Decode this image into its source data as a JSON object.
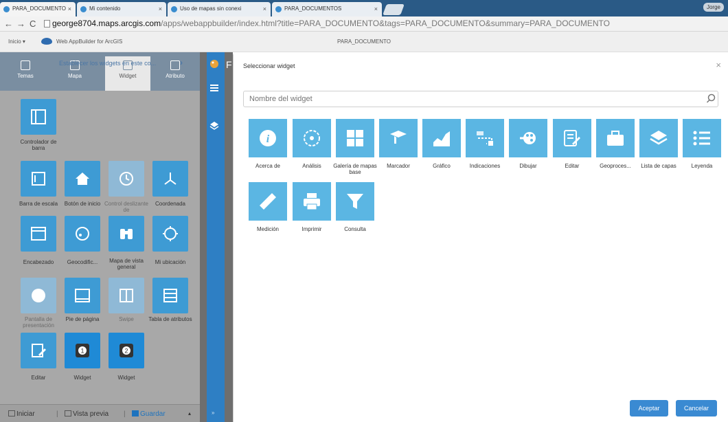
{
  "browser": {
    "tabs": [
      {
        "title": "PARA_DOCUMENTO"
      },
      {
        "title": "Mi contenido"
      },
      {
        "title": "Uso de mapas sin conexi"
      },
      {
        "title": "PARA_DOCUMENTOS"
      }
    ],
    "user": "Jorge",
    "url_domain": "george8704.maps.arcgis.com",
    "url_rest": "/apps/webappbuilder/index.html?title=PARA_DOCUMENTO&tags=PARA_DOCUMENTO&summary=PARA_DOCUMENTO"
  },
  "app_header": {
    "inicio": "Inicio ▾",
    "product": "Web AppBuilder for ArcGIS",
    "title": "PARA_DOCUMENTO"
  },
  "left_panel": {
    "tabs": [
      "Temas",
      "Mapa",
      "Widget",
      "Atributo"
    ],
    "controller_text": "Establecer los widgets en este co...",
    "controller_label": "Controlador de barra",
    "tiles": [
      "Barra de escala",
      "Botón de inicio",
      "Control deslizante de",
      "Coordenada",
      "Encabezado",
      "Geocodific...",
      "Mapa de vista general",
      "Mi ubicación",
      "Pantalla de presentación",
      "Pie de página",
      "Swipe",
      "Tabla de atributos",
      "Editar",
      "Widget",
      "Widget"
    ],
    "bottom": {
      "iniciar": "Iniciar",
      "vista_previa": "Vista previa",
      "guardar": "Guardar"
    }
  },
  "map_letter": "F",
  "dialog": {
    "title": "Seleccionar widget",
    "search_placeholder": "Nombre del widget",
    "widgets": [
      "Acerca de",
      "Análisis",
      "Galería de mapas base",
      "Marcador",
      "Gráfico",
      "Indicaciones",
      "Dibujar",
      "Editar",
      "Geoproces...",
      "Lista de capas",
      "Leyenda",
      "Medición",
      "Imprimir",
      "Consulta"
    ],
    "accept": "Aceptar",
    "cancel": "Cancelar"
  }
}
